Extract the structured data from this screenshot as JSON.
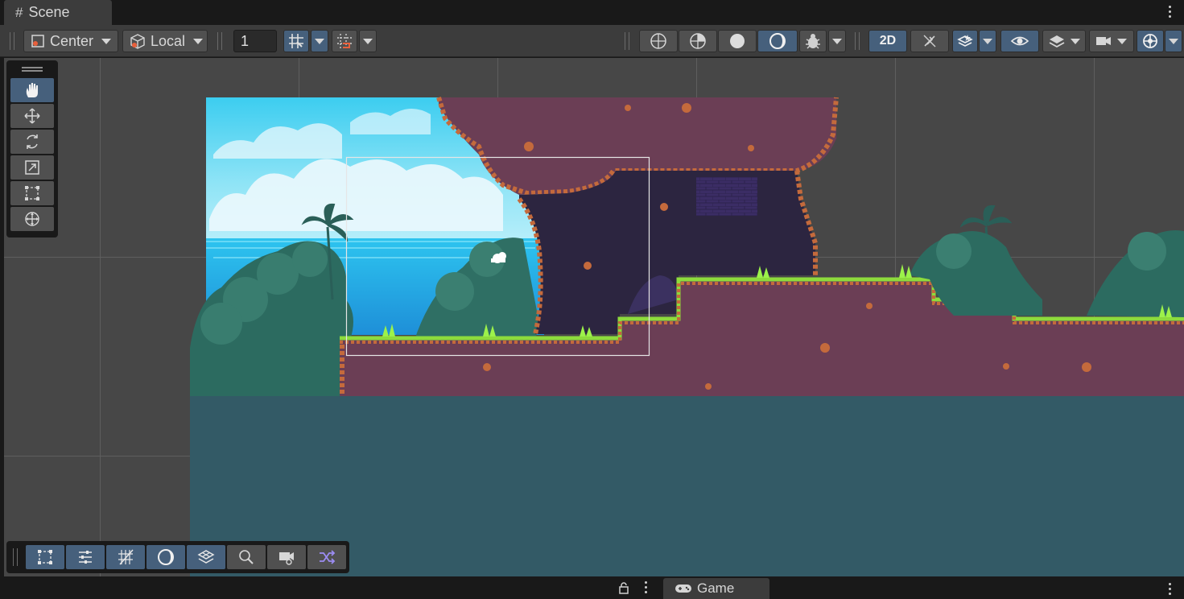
{
  "tabs": {
    "scene_label": "Scene",
    "game_label": "Game"
  },
  "toolbar": {
    "pivot_mode": "Center",
    "pivot_rotation": "Local",
    "grid_increment": "1",
    "view_2d_label": "2D"
  },
  "tools": [
    {
      "name": "hand-tool",
      "icon": "hand-icon",
      "active": true
    },
    {
      "name": "move-tool",
      "icon": "move-icon",
      "active": false
    },
    {
      "name": "rotate-tool",
      "icon": "rotate-icon",
      "active": false
    },
    {
      "name": "scale-tool",
      "icon": "scale-icon",
      "active": false
    },
    {
      "name": "rect-tool",
      "icon": "rect-icon",
      "active": false
    },
    {
      "name": "transform-tool",
      "icon": "transform-icon",
      "active": false
    }
  ],
  "overlays": [
    {
      "name": "overlay-rect-button",
      "icon": "rect-icon",
      "active": true
    },
    {
      "name": "overlay-settings-button",
      "icon": "sliders-icon",
      "active": true
    },
    {
      "name": "overlay-grid-button",
      "icon": "grid-icon",
      "active": true
    },
    {
      "name": "overlay-shading-button",
      "icon": "moon-icon",
      "active": true
    },
    {
      "name": "overlay-tilemap-button",
      "icon": "tilemap-icon",
      "active": true
    },
    {
      "name": "overlay-search-button",
      "icon": "search-icon",
      "active": false
    },
    {
      "name": "overlay-camera-button",
      "icon": "camera-icon",
      "active": false
    },
    {
      "name": "overlay-navigation-button",
      "icon": "shuffle-icon",
      "active": false
    }
  ],
  "colors": {
    "active_blue": "#46607c",
    "panel": "#3c3c3c",
    "sky_top": "#4fd3f0",
    "dirt": "#6b3e55",
    "grass": "#8ddb3c",
    "water_fill": "#335a66"
  }
}
